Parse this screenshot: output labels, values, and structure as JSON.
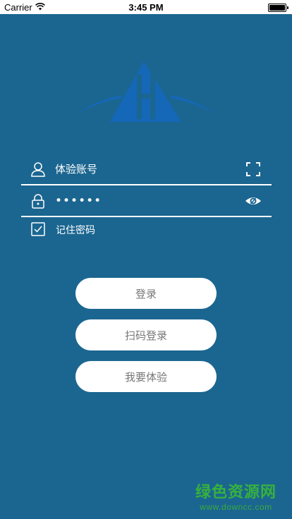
{
  "status_bar": {
    "carrier": "Carrier",
    "time": "3:45 PM"
  },
  "login_form": {
    "account_placeholder": "体验账号",
    "password_value": "••••••",
    "remember_label": "记住密码",
    "remember_checked": true
  },
  "buttons": {
    "login": "登录",
    "scan_login": "扫码登录",
    "try_it": "我要体验"
  },
  "watermark": {
    "main": "绿色资源网",
    "url": "www.downcc.com"
  },
  "icons": {
    "account": "user-icon",
    "password": "lock-icon",
    "scan": "scan-icon",
    "show_password": "eye-icon",
    "remember": "checkbox-checked-icon",
    "wifi": "wifi-icon",
    "battery": "battery-icon"
  },
  "colors": {
    "background": "#1b6690",
    "logo": "#1567b8",
    "button_bg": "#ffffff",
    "button_text": "#777777",
    "watermark": "#36b13d"
  }
}
